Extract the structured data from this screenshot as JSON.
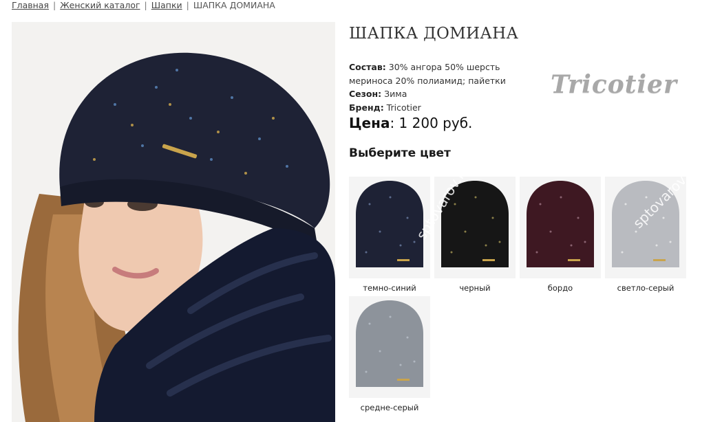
{
  "breadcrumb": {
    "home": "Главная",
    "catalog": "Женский каталог",
    "category": "Шапки",
    "current": "ШАПКА ДОМИАНА"
  },
  "product": {
    "title": "ШАПКА ДОМИАНА",
    "composition_label": "Состав",
    "composition_value": "30% ангора 50% шерсть мериноса 20% полиамид; пайетки",
    "season_label": "Сезон",
    "season_value": "Зима",
    "brand_label": "Бренд",
    "brand_value": "Tricotier",
    "price_label": "Цена",
    "price_value": "1 200 руб."
  },
  "brand_logo_text": "Tricotier",
  "choose_color_heading": "Выберите цвет",
  "colors": [
    {
      "name": "темно-синий",
      "hex": "#1e2235"
    },
    {
      "name": "черный",
      "hex": "#161616"
    },
    {
      "name": "бордо",
      "hex": "#3e1822"
    },
    {
      "name": "светло-серый",
      "hex": "#b9bbc0"
    },
    {
      "name": "средне-серый",
      "hex": "#8d939b"
    }
  ],
  "watermark_text": "sptovarov.ru"
}
